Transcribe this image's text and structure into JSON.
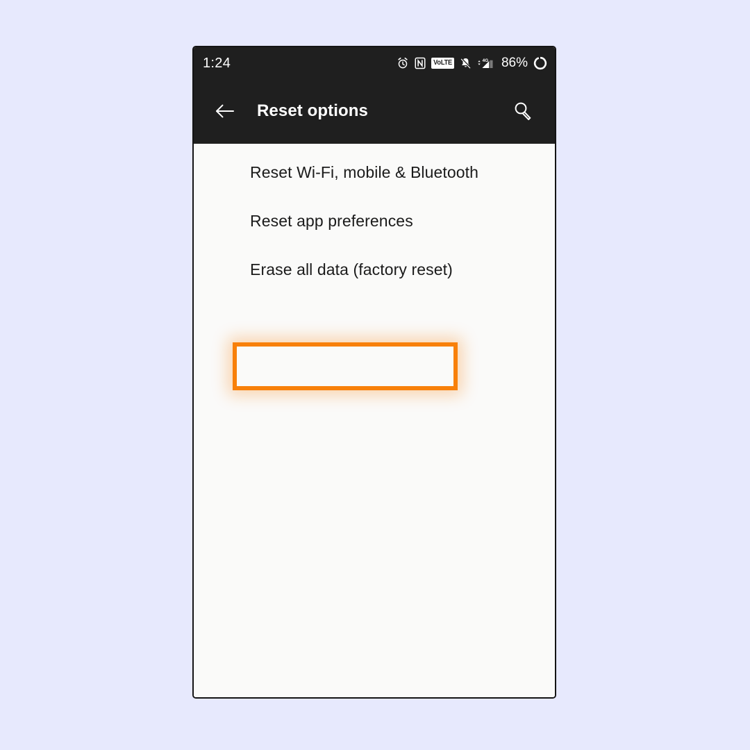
{
  "theme": {
    "page_background": "#E7E9FD",
    "bar_background": "#1F1F1F",
    "content_background": "#FAFAF9",
    "text_primary": "#1B1B1B",
    "text_on_bar": "#FFFFFF",
    "highlight_accent": "#F8800A"
  },
  "status_bar": {
    "time": "1:24",
    "battery_percent": "86%",
    "volte_label": "VoLTE",
    "network_label": "4G",
    "icons": [
      "alarm-clock-icon",
      "nfc-icon",
      "volte-icon",
      "notifications-muted-icon",
      "mobile-signal-4g-icon",
      "battery-ring-icon"
    ]
  },
  "app_bar": {
    "title": "Reset options",
    "back_icon": "back-arrow-icon",
    "search_icon": "search-icon"
  },
  "settings_list": {
    "items": [
      {
        "label": "Reset Wi-Fi, mobile & Bluetooth",
        "highlighted": false
      },
      {
        "label": "Reset app preferences",
        "highlighted": false
      },
      {
        "label": "Erase all data (factory reset)",
        "highlighted": true
      }
    ]
  }
}
